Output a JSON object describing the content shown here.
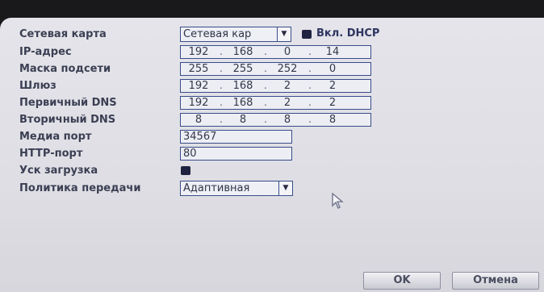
{
  "network": {
    "nic": {
      "label": "Сетевая карта",
      "value": "Сетевая кар"
    },
    "dhcp": {
      "label": "Вкл. DHCP",
      "checked": true
    },
    "ip": {
      "label": "IP-адрес",
      "octets": [
        "192",
        "168",
        "0",
        "14"
      ]
    },
    "mask": {
      "label": "Маска подсети",
      "octets": [
        "255",
        "255",
        "252",
        "0"
      ]
    },
    "gateway": {
      "label": "Шлюз",
      "octets": [
        "192",
        "168",
        "2",
        "2"
      ]
    },
    "dns1": {
      "label": "Первичный DNS",
      "octets": [
        "192",
        "168",
        "2",
        "2"
      ]
    },
    "dns2": {
      "label": "Вторичный DNS",
      "octets": [
        "8",
        "8",
        "8",
        "8"
      ]
    },
    "media_port": {
      "label": "Медиа порт",
      "value": "34567"
    },
    "http_port": {
      "label": "HTTP-порт",
      "value": "80"
    },
    "fast_boot": {
      "label": "Уск загрузка",
      "checked": true
    },
    "policy": {
      "label": "Политика передачи",
      "value": "Адаптивная"
    }
  },
  "buttons": {
    "ok": "OK",
    "cancel": "Отмена"
  },
  "icons": {
    "dropdown": "chevron-down-icon",
    "pointer": "mouse-pointer-icon"
  },
  "colors": {
    "field_border": "#3a4c8a",
    "label": "#3b3f53",
    "panel": "#e4e4ea"
  }
}
